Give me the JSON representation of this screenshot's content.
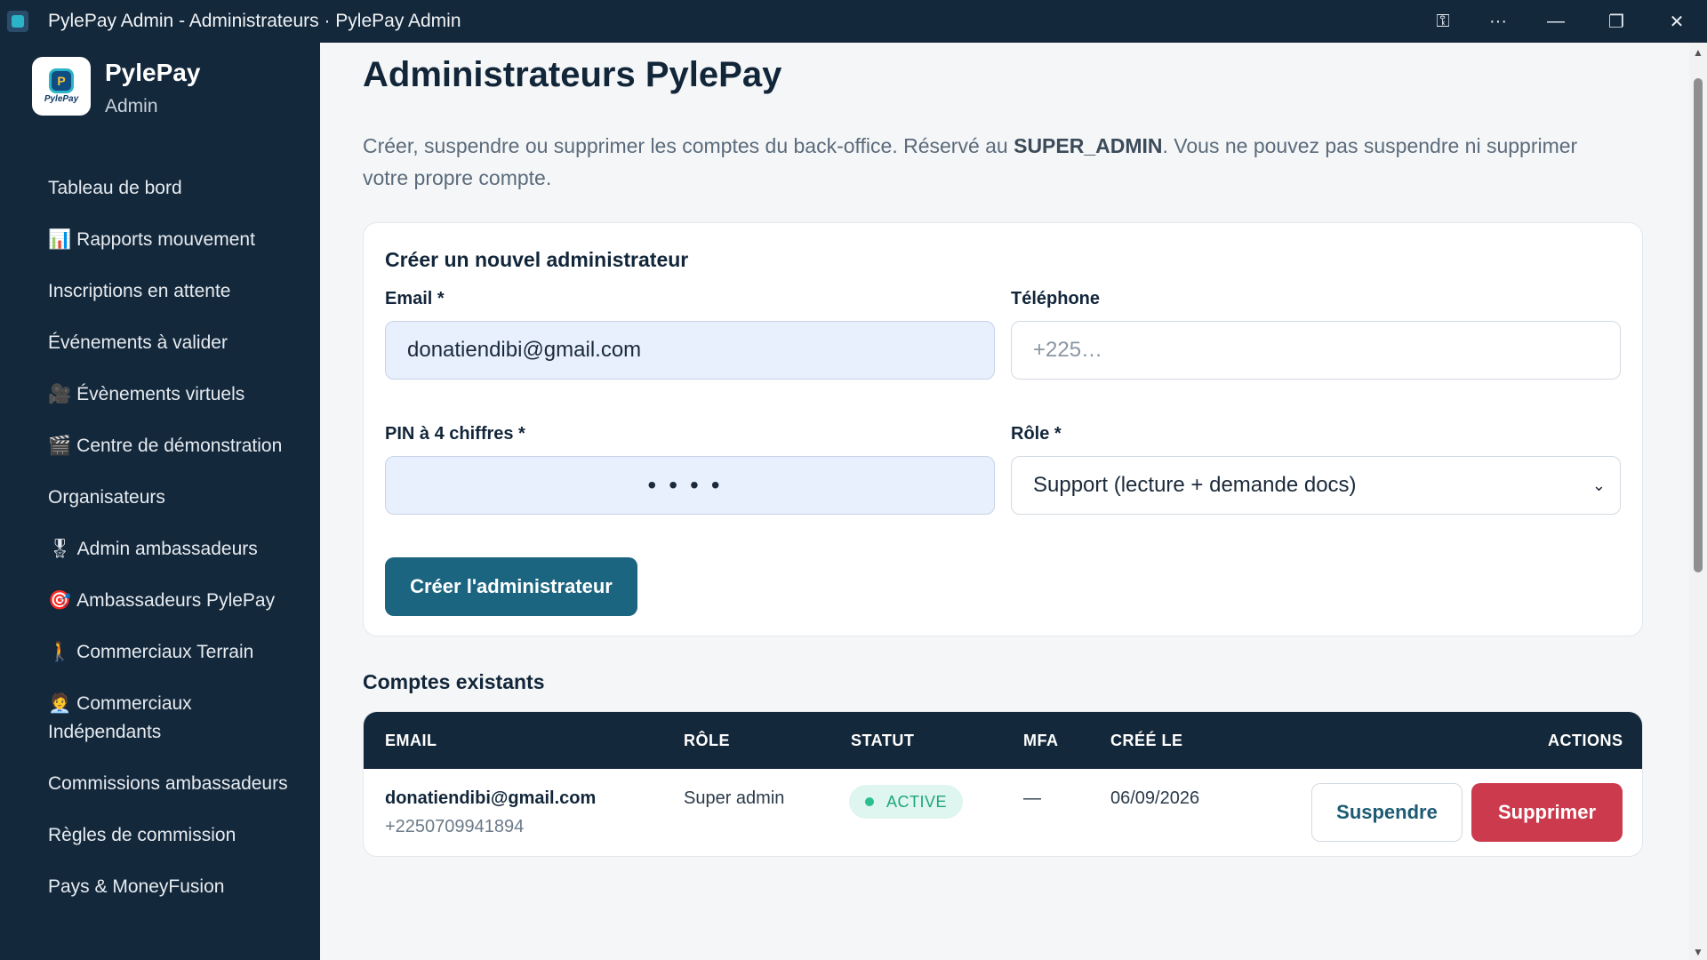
{
  "window": {
    "title": "PylePay Admin - Administrateurs · PylePay Admin",
    "controls": {
      "key": "⚿",
      "more": "···",
      "minimize": "—",
      "restore": "❐",
      "close": "✕"
    }
  },
  "brand": {
    "name": "PylePay",
    "subtitle": "Admin",
    "logo_text": "PylePay",
    "logo_mark": "P"
  },
  "sidebar": {
    "items": [
      {
        "icon": "",
        "label": "Tableau de bord"
      },
      {
        "icon": "📊",
        "label": "Rapports mouvement"
      },
      {
        "icon": "",
        "label": "Inscriptions en attente"
      },
      {
        "icon": "",
        "label": "Événements à valider"
      },
      {
        "icon": "🎥",
        "label": "Évènements virtuels"
      },
      {
        "icon": "🎬",
        "label": "Centre de démonstration"
      },
      {
        "icon": "",
        "label": "Organisateurs"
      },
      {
        "icon": "🎖",
        "label": "Admin ambassadeurs"
      },
      {
        "icon": "🎯",
        "label": "Ambassadeurs PylePay"
      },
      {
        "icon": "🚶",
        "label": "Commerciaux Terrain"
      },
      {
        "icon": "🧑‍💼",
        "label": "Commerciaux Indépendants"
      },
      {
        "icon": "",
        "label": "Commissions ambassadeurs"
      },
      {
        "icon": "",
        "label": "Règles de commission"
      },
      {
        "icon": "",
        "label": "Pays & MoneyFusion"
      }
    ]
  },
  "page": {
    "title": "Administrateurs PylePay",
    "desc_before": "Créer, suspendre ou supprimer les comptes du back-office. Réservé au ",
    "desc_bold": "SUPER_ADMIN",
    "desc_after": ". Vous ne pouvez pas suspendre ni supprimer votre propre compte."
  },
  "create_form": {
    "title": "Créer un nouvel administrateur",
    "email_label": "Email *",
    "email_value": "donatiendibi@gmail.com",
    "phone_label": "Téléphone",
    "phone_placeholder": "+225…",
    "pin_label": "PIN à 4 chiffres *",
    "pin_value": "••••",
    "role_label": "Rôle *",
    "role_value": "Support (lecture + demande docs)",
    "submit_label": "Créer l'administrateur"
  },
  "accounts": {
    "title": "Comptes existants",
    "columns": [
      "EMAIL",
      "RÔLE",
      "STATUT",
      "MFA",
      "CRÉÉ LE",
      "ACTIONS"
    ],
    "rows": [
      {
        "email": "donatiendibi@gmail.com",
        "phone": "+2250709941894",
        "role": "Super admin",
        "status": "ACTIVE",
        "mfa": "—",
        "created": "06/09/2026",
        "suspend_label": "Suspendre",
        "delete_label": "Supprimer"
      }
    ]
  },
  "colors": {
    "navy": "#14283b",
    "primary_button": "#1c6580",
    "danger": "#cc3a4d",
    "status_active": "#1ea67a"
  }
}
